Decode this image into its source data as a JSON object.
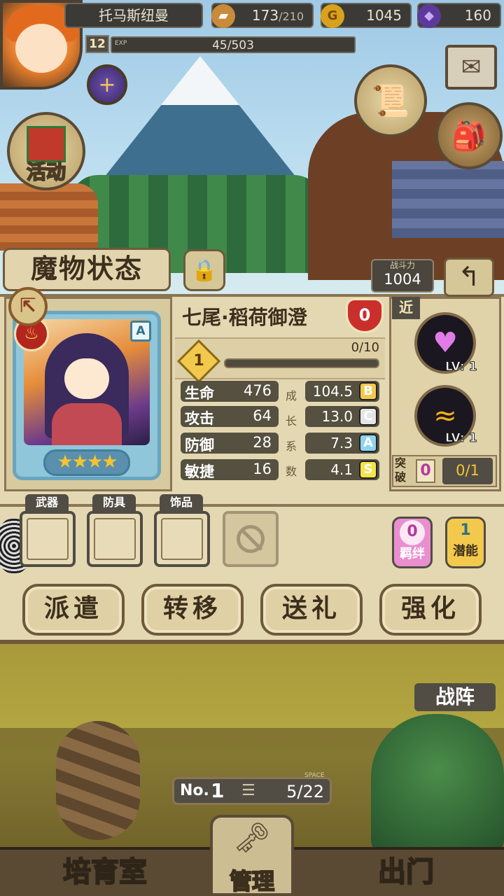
{
  "hud": {
    "player_name": "托马斯纽曼",
    "level": "12",
    "exp_label": "EXP",
    "exp_text": "45/503",
    "stamina_current": "173",
    "stamina_max": "/210",
    "gold_icon": "G",
    "gold": "1045",
    "gems": "160"
  },
  "left_buttons": {
    "event_label": "活动"
  },
  "panel": {
    "title": "魔物状态",
    "power_label": "战斗力",
    "power_value": "1004",
    "monster_name": "七尾·稻荷御澄",
    "bond_value": "0",
    "card_rank": "A",
    "stars": "★★★★",
    "rank_level": "1",
    "rank_progress_text": "0/10",
    "rank_progress_fraction": 0.0,
    "stats": [
      {
        "name": "生命",
        "value": "476",
        "growth": "104.5",
        "grade": "B",
        "grade_color": "#f2c94c"
      },
      {
        "name": "攻击",
        "value": "64",
        "growth": "13.0",
        "grade": "C",
        "grade_color": "#e5e5e5"
      },
      {
        "name": "防御",
        "value": "28",
        "growth": "7.3",
        "grade": "A",
        "grade_color": "#8fd3f0"
      },
      {
        "name": "敏捷",
        "value": "16",
        "growth": "4.1",
        "grade": "S",
        "grade_color": "#f4e34a"
      }
    ],
    "growth_title": "成长系数",
    "range_tag": "近",
    "skills": [
      {
        "icon": "hearts-skill-icon",
        "level": "LV: 1"
      },
      {
        "icon": "fire-slash-skill-icon",
        "level": "LV: 1"
      }
    ],
    "break_label": "突破",
    "break_value": "0",
    "break_count": "0/1",
    "equipment": [
      {
        "label": "武器"
      },
      {
        "label": "防具"
      },
      {
        "label": "饰品"
      }
    ],
    "fetter": {
      "value": "0",
      "label": "羁绊"
    },
    "potential": {
      "value": "1",
      "label": "潜能"
    },
    "actions": [
      "派遣",
      "转移",
      "送礼",
      "强化"
    ]
  },
  "lower": {
    "formation_label": "战阵",
    "counter_no_prefix": "No.",
    "counter_no": "1",
    "counter_space_label": "SPACE",
    "counter_value": "5/22",
    "nav": {
      "left": "培育室",
      "center": "管理",
      "right": "出门"
    }
  },
  "colors": {
    "panel_bg": "#e4d8b3",
    "frame_dark": "#514d44",
    "accent_gold": "#f4c430",
    "bond_red": "#c9302c"
  }
}
